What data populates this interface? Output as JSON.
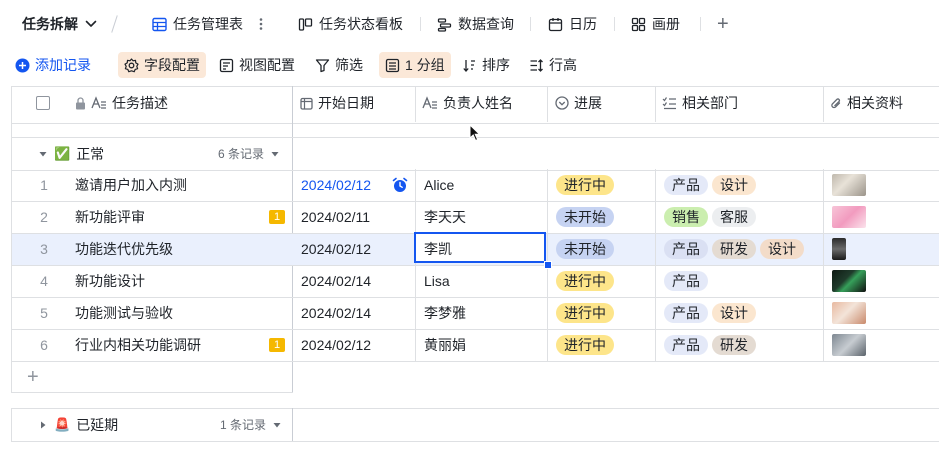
{
  "topbar": {
    "title": "任务拆解",
    "tabs": [
      {
        "label": "任务管理表",
        "icon": "table-icon",
        "active": true
      },
      {
        "label": "任务状态看板",
        "icon": "kanban-icon",
        "active": false
      },
      {
        "label": "数据查询",
        "icon": "query-icon",
        "active": false
      },
      {
        "label": "日历",
        "icon": "calendar-icon",
        "active": false
      },
      {
        "label": "画册",
        "icon": "gallery-icon",
        "active": false
      }
    ],
    "add_tab": "+"
  },
  "toolbar": {
    "add_record": "添加记录",
    "field_config": "字段配置",
    "view_config": "视图配置",
    "filter": "筛选",
    "group": "1 分组",
    "sort": "排序",
    "row_height": "行高"
  },
  "columns": [
    "任务描述",
    "开始日期",
    "负责人姓名",
    "进展",
    "相关部门",
    "相关资料"
  ],
  "groups": [
    {
      "emoji": "✅",
      "name": "正常",
      "count": "6 条记录",
      "expanded": true
    },
    {
      "emoji": "🚨",
      "name": "已延期",
      "count": "1 条记录",
      "expanded": false
    }
  ],
  "rows": [
    {
      "num": "1",
      "task": "邀请用户加入内测",
      "date": "2024/02/12",
      "owner": "Alice",
      "status": "进行中",
      "depts": [
        "产品",
        "设计"
      ],
      "badge": ""
    },
    {
      "num": "2",
      "task": "新功能评审",
      "date": "2024/02/11",
      "owner": "李天天",
      "status": "未开始",
      "depts": [
        "销售",
        "客服"
      ],
      "badge": "1"
    },
    {
      "num": "3",
      "task": "功能迭代优先级",
      "date": "2024/02/12",
      "owner": "李凯",
      "status": "未开始",
      "depts": [
        "产品",
        "研发",
        "设计"
      ],
      "badge": ""
    },
    {
      "num": "4",
      "task": "新功能设计",
      "date": "2024/02/14",
      "owner": "Lisa",
      "status": "进行中",
      "depts": [
        "产品"
      ],
      "badge": ""
    },
    {
      "num": "5",
      "task": "功能测试与验收",
      "date": "2024/02/14",
      "owner": "李梦雅",
      "status": "进行中",
      "depts": [
        "产品",
        "设计"
      ],
      "badge": ""
    },
    {
      "num": "6",
      "task": "行业内相关功能调研",
      "date": "2024/02/12",
      "owner": "黄丽娟",
      "status": "进行中",
      "depts": [
        "产品",
        "研发"
      ],
      "badge": "1"
    }
  ],
  "add_row": "+",
  "colors": {
    "accent": "#1456f0",
    "status_in_progress": "#fde58a",
    "status_not_started": "#c6d3f2",
    "dept_product": "#e4e9f8",
    "dept_design": "#fbe6cf",
    "dept_sales": "#cbeeaf",
    "dept_service": "#eceef0",
    "dept_rd": "#e4dbd2",
    "row_selected": "#eaf0fd",
    "toolbar_active": "#fbe8d8"
  }
}
